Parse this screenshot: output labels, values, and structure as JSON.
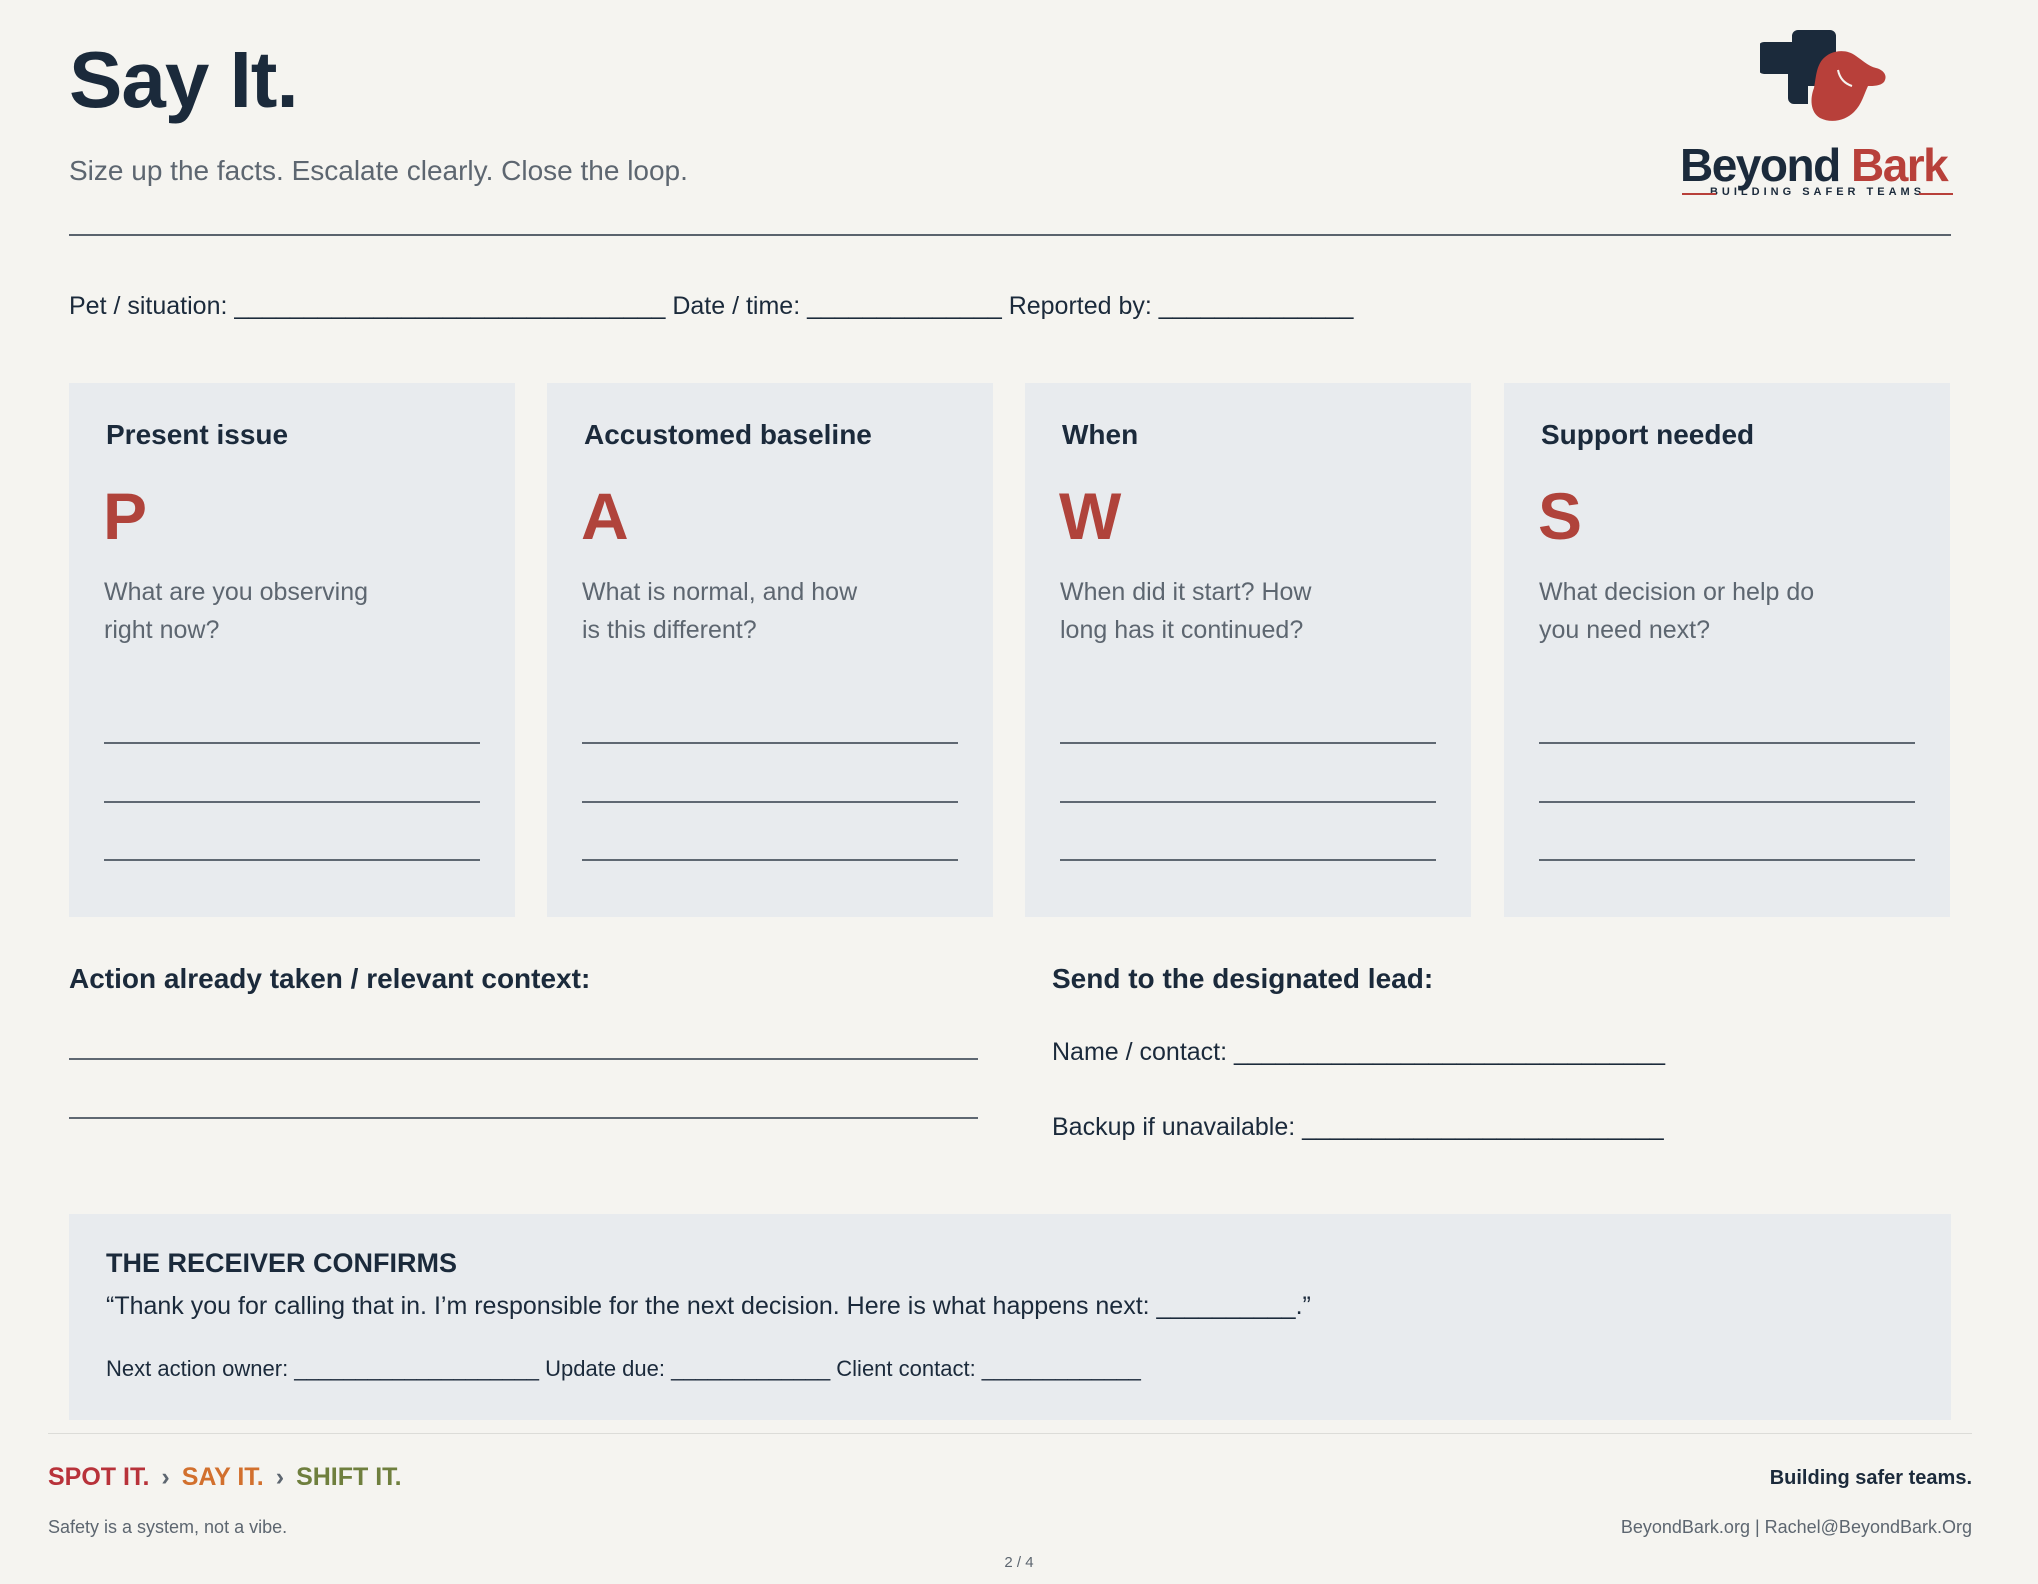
{
  "header": {
    "title": "Say It.",
    "subtitle": "Size up the facts. Escalate clearly. Close the loop."
  },
  "logo": {
    "word1": "Beyond",
    "word2": "Bark",
    "tagline": "BUILDING SAFER TEAMS"
  },
  "meta_line": "Pet / situation: _______________________________ Date / time: ______________ Reported by: ______________",
  "cards": [
    {
      "title": "Present issue",
      "letter": "P",
      "question": "What are you observing right now?"
    },
    {
      "title": "Accustomed baseline",
      "letter": "A",
      "question": "What is normal, and how is this different?"
    },
    {
      "title": "When",
      "letter": "W",
      "question": "When did it start? How long has it continued?"
    },
    {
      "title": "Support needed",
      "letter": "S",
      "question": "What decision or help do you need next?"
    }
  ],
  "action_section": {
    "heading": "Action already taken / relevant context:"
  },
  "lead_section": {
    "heading": "Send to the designated lead:",
    "name_line": "Name / contact: _______________________________",
    "backup_line": "Backup if unavailable: __________________________"
  },
  "receiver": {
    "heading": "THE RECEIVER CONFIRMS",
    "quote": "“Thank you for calling that in. I’m responsible for the next decision. Here is what happens next: __________.”",
    "meta": "Next action owner: ____________________ Update due: _____________ Client contact: _____________"
  },
  "footer": {
    "step1": "SPOT IT.",
    "step2": "SAY IT.",
    "step3": "SHIFT IT.",
    "separator": "›",
    "tagline": "Building safer teams.",
    "motto": "Safety is a system, not a vibe.",
    "contact": "BeyondBark.org | Rachel@BeyondBark.Org",
    "page": "2 / 4"
  },
  "colors": {
    "navy": "#1b2a3b",
    "brand_red": "#b0433b",
    "spot": "#b8323a",
    "say": "#d2702e",
    "shift": "#6f7f3e",
    "card_bg": "#e8ebee",
    "page_bg": "#f5f4f0"
  }
}
